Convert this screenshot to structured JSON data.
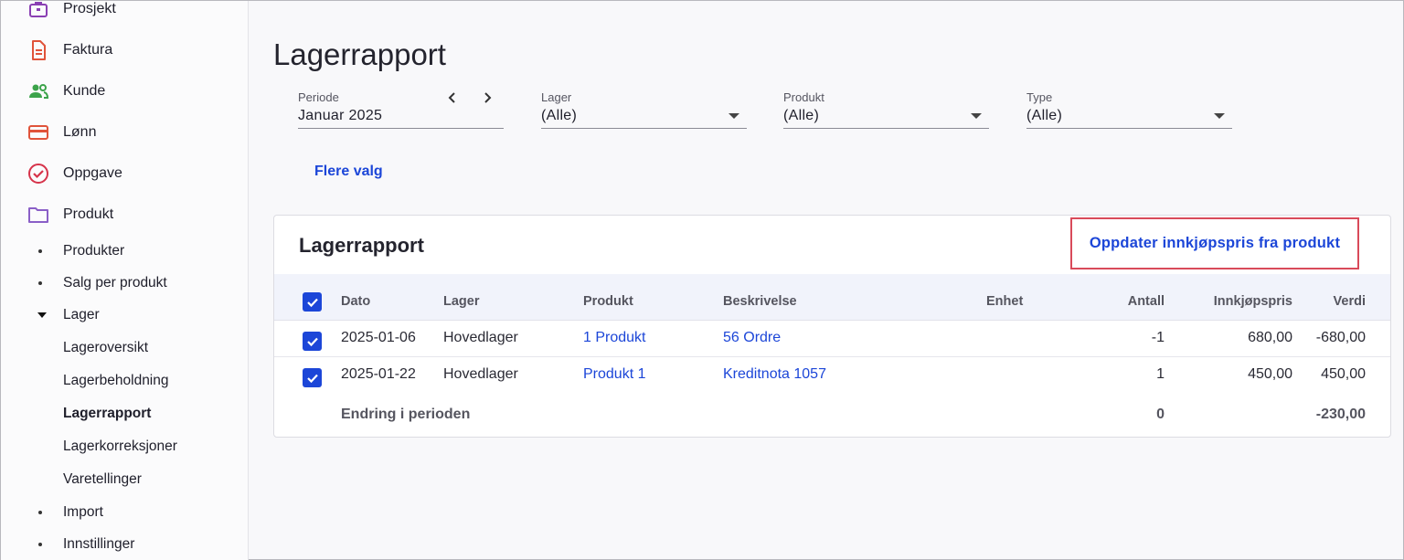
{
  "sidebar": {
    "items": [
      {
        "label": "Prosjekt",
        "icon": "briefcase-icon",
        "color": "#8a3fb3"
      },
      {
        "label": "Faktura",
        "icon": "invoice-icon",
        "color": "#e0533a"
      },
      {
        "label": "Kunde",
        "icon": "users-icon",
        "color": "#3ba34a"
      },
      {
        "label": "Lønn",
        "icon": "credit-card-icon",
        "color": "#e0533a"
      },
      {
        "label": "Oppgave",
        "icon": "check-circle-icon",
        "color": "#d6334a"
      },
      {
        "label": "Produkt",
        "icon": "folder-icon",
        "color": "#8a5fc7"
      }
    ],
    "produkt_sub": [
      {
        "label": "Produkter"
      },
      {
        "label": "Salg per produkt"
      },
      {
        "label": "Lager"
      }
    ],
    "lager_sub": [
      {
        "label": "Lageroversikt"
      },
      {
        "label": "Lagerbeholdning"
      },
      {
        "label": "Lagerrapport"
      },
      {
        "label": "Lagerkorreksjoner"
      },
      {
        "label": "Varetellinger"
      }
    ],
    "bottom_sub": [
      {
        "label": "Import"
      },
      {
        "label": "Innstillinger"
      }
    ]
  },
  "page_title": "Lagerrapport",
  "filters": {
    "periode": {
      "label": "Periode",
      "value": "Januar 2025"
    },
    "lager": {
      "label": "Lager",
      "value": "(Alle)"
    },
    "produkt": {
      "label": "Produkt",
      "value": "(Alle)"
    },
    "type": {
      "label": "Type",
      "value": "(Alle)"
    }
  },
  "more_options": "Flere valg",
  "card": {
    "title": "Lagerrapport",
    "update_button": "Oppdater innkjøpspris fra produkt",
    "columns": {
      "dato": "Dato",
      "lager": "Lager",
      "produkt": "Produkt",
      "beskrivelse": "Beskrivelse",
      "enhet": "Enhet",
      "antall": "Antall",
      "innkjopspris": "Innkjøpspris",
      "verdi": "Verdi"
    },
    "rows": [
      {
        "dato": "2025-01-06",
        "lager": "Hovedlager",
        "produkt": "1 Produkt",
        "beskrivelse": "56 Ordre",
        "enhet": "",
        "antall": "-1",
        "innkjopspris": "680,00",
        "verdi": "-680,00",
        "checked": true
      },
      {
        "dato": "2025-01-22",
        "lager": "Hovedlager",
        "produkt": "Produkt 1",
        "beskrivelse": "Kreditnota 1057",
        "enhet": "",
        "antall": "1",
        "innkjopspris": "450,00",
        "verdi": "450,00",
        "checked": true
      }
    ],
    "summary": {
      "label": "Endring i perioden",
      "antall": "0",
      "verdi": "-230,00"
    }
  },
  "colors": {
    "accent": "#1c46d8",
    "highlight_border": "#d94a5a"
  }
}
